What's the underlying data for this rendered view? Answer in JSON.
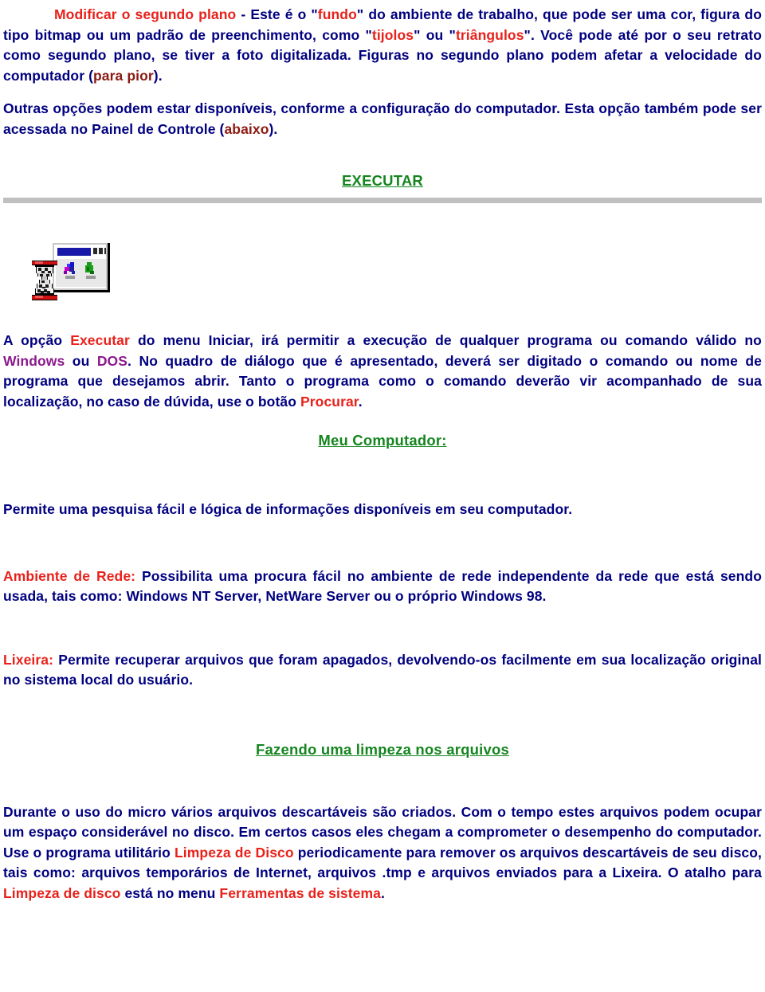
{
  "document": {
    "language": "pt-BR",
    "colors": {
      "body_text": "#000080",
      "accent_red": "#e8211b",
      "accent_maroon": "#8b1a12",
      "accent_purple": "#8b1a8b",
      "heading_green": "#15851f",
      "rule_gray": "#c0c0c0",
      "background": "#ffffff"
    },
    "paragraphs": {
      "background_intro": {
        "lead_red": "Modificar o segundo plano",
        "after_lead": " - Este é o \"",
        "quoted_red_1": "fundo",
        "mid_1": "\" do ambiente de trabalho, que pode ser uma cor, figura do tipo bitmap ou um padrão de preenchimento, como \"",
        "quoted_red_2": "tijolos",
        "mid_2": "\" ou \"",
        "quoted_red_3": "triângulos",
        "mid_3": "\".  Você pode até por o seu retrato como segundo plano, se tiver a foto digitalizada. Figuras no segundo plano podem afetar a velocidade do computador (",
        "maroon_1": "para pior",
        "tail": ")."
      },
      "other_options": {
        "part_1": "Outras opções podem estar disponíveis, conforme a configuração do computador. Esta opção também pode ser acessada no Painel de Controle (",
        "maroon_1": "abaixo",
        "tail": ")."
      },
      "executar_body": {
        "part_1": "A opção ",
        "red_1": "Executar",
        "part_2": " do menu Iniciar, irá permitir a execução de qualquer programa ou comando válido no ",
        "purple_1": "Windows",
        "part_3": " ou ",
        "purple_2": "DOS",
        "part_4": ". No quadro de diálogo que é apresentado, deverá ser digitado o comando ou nome de programa que desejamos abrir. Tanto o programa como o comando deverão vir acompanhado de sua localização, no caso de dúvida, use o botão ",
        "red_2": "Procurar",
        "tail": "."
      },
      "meu_computador_body": "Permite uma pesquisa fácil e lógica de informações disponíveis em seu computador.",
      "ambiente_rede": {
        "red_label": "Ambiente de Rede:",
        "body": " Possibilita uma procura fácil no ambiente de rede independente da rede que está sendo usada, tais como: Windows NT Server, NetWare Server ou o próprio Windows 98."
      },
      "lixeira": {
        "red_label": "Lixeira:",
        "body": " Permite recuperar arquivos que foram apagados, devolvendo-os facilmente em sua localização original no sistema local do usuário."
      },
      "limpeza_body": {
        "part_1": "Durante o uso do micro vários arquivos descartáveis são criados. Com o tempo estes arquivos podem ocupar um espaço considerável no disco. Em certos casos eles chegam a comprometer o desempenho do computador. Use o programa utilitário ",
        "red_1": "Limpeza de Disco",
        "part_2": " periodicamente para remover os arquivos descartáveis de seu disco, tais como: arquivos temporários de Internet, arquivos .tmp e arquivos enviados para a Lixeira. O atalho para ",
        "red_2": "Limpeza de disco",
        "part_3": " está no menu ",
        "red_3": "Ferramentas de sistema",
        "tail": "."
      }
    },
    "headings": {
      "executar": "EXECUTAR",
      "meu_computador": "Meu Computador:",
      "limpeza": "Fazendo uma limpeza nos arquivos"
    },
    "icons": {
      "run_dialog": "run-dialog-hourglass-icon"
    }
  }
}
